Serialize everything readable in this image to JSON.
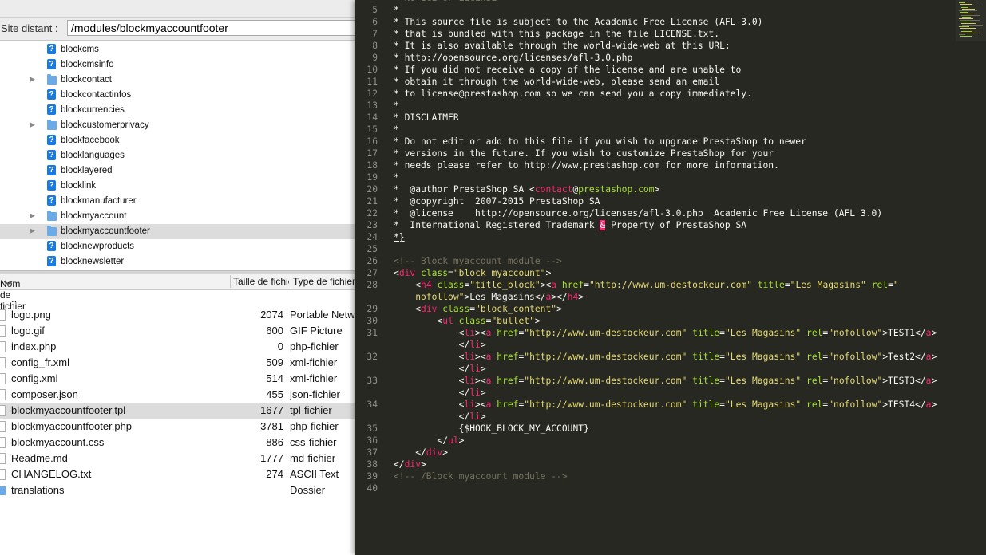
{
  "site_bar": {
    "label": "Site distant :",
    "path": "/modules/blockmyaccountfooter"
  },
  "tree": {
    "items": [
      {
        "name": "blockcms",
        "icon": "unknown-icon",
        "expandable": false,
        "selected": false
      },
      {
        "name": "blockcmsinfo",
        "icon": "unknown-icon",
        "expandable": false,
        "selected": false
      },
      {
        "name": "blockcontact",
        "icon": "folder-icon",
        "expandable": true,
        "selected": false
      },
      {
        "name": "blockcontactinfos",
        "icon": "unknown-icon",
        "expandable": false,
        "selected": false
      },
      {
        "name": "blockcurrencies",
        "icon": "unknown-icon",
        "expandable": false,
        "selected": false
      },
      {
        "name": "blockcustomerprivacy",
        "icon": "folder-icon",
        "expandable": true,
        "selected": false
      },
      {
        "name": "blockfacebook",
        "icon": "unknown-icon",
        "expandable": false,
        "selected": false
      },
      {
        "name": "blocklanguages",
        "icon": "unknown-icon",
        "expandable": false,
        "selected": false
      },
      {
        "name": "blocklayered",
        "icon": "unknown-icon",
        "expandable": false,
        "selected": false
      },
      {
        "name": "blocklink",
        "icon": "unknown-icon",
        "expandable": false,
        "selected": false
      },
      {
        "name": "blockmanufacturer",
        "icon": "unknown-icon",
        "expandable": false,
        "selected": false
      },
      {
        "name": "blockmyaccount",
        "icon": "folder-icon",
        "expandable": true,
        "selected": false
      },
      {
        "name": "blockmyaccountfooter",
        "icon": "folder-icon",
        "expandable": true,
        "selected": true
      },
      {
        "name": "blocknewproducts",
        "icon": "unknown-icon",
        "expandable": false,
        "selected": false
      },
      {
        "name": "blocknewsletter",
        "icon": "unknown-icon",
        "expandable": false,
        "selected": false
      }
    ]
  },
  "file_list": {
    "headers": {
      "name": "Nom de fichier",
      "size": "Taille de fichier",
      "type": "Type de fichier"
    },
    "rows": [
      {
        "name": "..",
        "size": "",
        "type": "",
        "icon": "none"
      },
      {
        "name": "logo.png",
        "size": "2074",
        "type": "Portable Network Graphics",
        "icon": "file"
      },
      {
        "name": "logo.gif",
        "size": "600",
        "type": "GIF Picture",
        "icon": "file"
      },
      {
        "name": "index.php",
        "size": "0",
        "type": "php-fichier",
        "icon": "file"
      },
      {
        "name": "config_fr.xml",
        "size": "509",
        "type": "xml-fichier",
        "icon": "file"
      },
      {
        "name": "config.xml",
        "size": "514",
        "type": "xml-fichier",
        "icon": "file"
      },
      {
        "name": "composer.json",
        "size": "455",
        "type": "json-fichier",
        "icon": "file"
      },
      {
        "name": "blockmyaccountfooter.tpl",
        "size": "1677",
        "type": "tpl-fichier",
        "icon": "file",
        "selected": true
      },
      {
        "name": "blockmyaccountfooter.php",
        "size": "3781",
        "type": "php-fichier",
        "icon": "file"
      },
      {
        "name": "blockmyaccount.css",
        "size": "886",
        "type": "css-fichier",
        "icon": "file"
      },
      {
        "name": "Readme.md",
        "size": "1777",
        "type": "md-fichier",
        "icon": "file"
      },
      {
        "name": "CHANGELOG.txt",
        "size": "274",
        "type": "ASCII Text",
        "icon": "file"
      },
      {
        "name": "translations",
        "size": "",
        "type": "Dossier",
        "icon": "folder"
      }
    ]
  },
  "editor": {
    "theme": {
      "bg": "#272822",
      "text": "#f8f8f2",
      "comment": "#75715e",
      "tag": "#f92672",
      "attr": "#a6e22e",
      "string": "#e6db74",
      "gutter": "#8f908a"
    },
    "lines": [
      {
        "n": "",
        "t": [
          [
            "c",
            "* NOTICE OF LICENSE"
          ]
        ]
      },
      {
        "n": "5",
        "t": [
          [
            "t",
            "*"
          ]
        ]
      },
      {
        "n": "6",
        "t": [
          [
            "t",
            "* This source file is subject to the Academic Free License (AFL 3.0)"
          ]
        ]
      },
      {
        "n": "7",
        "t": [
          [
            "t",
            "* that is bundled with this package in the file LICENSE.txt."
          ]
        ]
      },
      {
        "n": "8",
        "t": [
          [
            "t",
            "* It is also available through the world-wide-web at this URL:"
          ]
        ]
      },
      {
        "n": "9",
        "t": [
          [
            "t",
            "* http://opensource.org/licenses/afl-3.0.php"
          ]
        ]
      },
      {
        "n": "10",
        "t": [
          [
            "t",
            "* If you did not receive a copy of the license and are unable to"
          ]
        ]
      },
      {
        "n": "11",
        "t": [
          [
            "t",
            "* obtain it through the world-wide-web, please send an email"
          ]
        ]
      },
      {
        "n": "12",
        "t": [
          [
            "t",
            "* to license@prestashop.com so we can send you a copy immediately."
          ]
        ]
      },
      {
        "n": "13",
        "t": [
          [
            "t",
            "*"
          ]
        ]
      },
      {
        "n": "14",
        "t": [
          [
            "t",
            "* DISCLAIMER"
          ]
        ]
      },
      {
        "n": "15",
        "t": [
          [
            "t",
            "*"
          ]
        ]
      },
      {
        "n": "16",
        "t": [
          [
            "t",
            "* Do not edit or add to this file if you wish to upgrade PrestaShop to newer"
          ]
        ]
      },
      {
        "n": "17",
        "t": [
          [
            "t",
            "* versions in the future. If you wish to customize PrestaShop for your"
          ]
        ]
      },
      {
        "n": "18",
        "t": [
          [
            "t",
            "* needs please refer to http://www.prestashop.com for more information."
          ]
        ]
      },
      {
        "n": "19",
        "t": [
          [
            "t",
            "*"
          ]
        ]
      },
      {
        "n": "20",
        "t": [
          [
            "t",
            "*  @author PrestaShop SA <"
          ],
          [
            "g",
            "contact"
          ],
          [
            "t",
            "@"
          ],
          [
            "a",
            "prestashop.com"
          ],
          [
            "t",
            ">"
          ]
        ]
      },
      {
        "n": "21",
        "t": [
          [
            "t",
            "*  @copyright  2007-2015 PrestaShop SA"
          ]
        ]
      },
      {
        "n": "22",
        "t": [
          [
            "t",
            "*  @license    http://opensource.org/licenses/afl-3.0.php  Academic Free License (AFL 3.0)"
          ]
        ]
      },
      {
        "n": "23",
        "t": [
          [
            "t",
            "*  International Registered Trademark "
          ],
          [
            "hl",
            "&"
          ],
          [
            "t",
            " Property of PrestaShop SA"
          ]
        ]
      },
      {
        "n": "24",
        "t": [
          [
            "cur",
            "*}"
          ]
        ]
      },
      {
        "n": "25",
        "t": []
      },
      {
        "n": "26",
        "t": [
          [
            "c",
            "<!-- Block myaccount module -->"
          ]
        ]
      },
      {
        "n": "27",
        "t": [
          [
            "t",
            "<"
          ],
          [
            "g",
            "div"
          ],
          [
            "t",
            " "
          ],
          [
            "a",
            "class"
          ],
          [
            "t",
            "="
          ],
          [
            "s",
            "\"block myaccount\""
          ],
          [
            "t",
            ">"
          ]
        ]
      },
      {
        "n": "28",
        "t": [
          [
            "t",
            "    <"
          ],
          [
            "g",
            "h4"
          ],
          [
            "t",
            " "
          ],
          [
            "a",
            "class"
          ],
          [
            "t",
            "="
          ],
          [
            "s",
            "\"title_block\""
          ],
          [
            "t",
            "><"
          ],
          [
            "g",
            "a"
          ],
          [
            "t",
            " "
          ],
          [
            "a",
            "href"
          ],
          [
            "t",
            "="
          ],
          [
            "s",
            "\"http://www.um-destockeur.com\""
          ],
          [
            "t",
            " "
          ],
          [
            "a",
            "title"
          ],
          [
            "t",
            "="
          ],
          [
            "s",
            "\"Les Magasins\""
          ],
          [
            "t",
            " "
          ],
          [
            "a",
            "rel"
          ],
          [
            "t",
            "="
          ],
          [
            "s",
            "\""
          ]
        ]
      },
      {
        "n": "",
        "t": [
          [
            "s",
            "    nofollow\""
          ],
          [
            "t",
            ">Les Magasins</"
          ],
          [
            "g",
            "a"
          ],
          [
            "t",
            "></"
          ],
          [
            "g",
            "h4"
          ],
          [
            "t",
            ">"
          ]
        ]
      },
      {
        "n": "29",
        "t": [
          [
            "t",
            "    <"
          ],
          [
            "g",
            "div"
          ],
          [
            "t",
            " "
          ],
          [
            "a",
            "class"
          ],
          [
            "t",
            "="
          ],
          [
            "s",
            "\"block_content\""
          ],
          [
            "t",
            ">"
          ]
        ]
      },
      {
        "n": "30",
        "t": [
          [
            "t",
            "        <"
          ],
          [
            "g",
            "ul"
          ],
          [
            "t",
            " "
          ],
          [
            "a",
            "class"
          ],
          [
            "t",
            "="
          ],
          [
            "s",
            "\"bullet\""
          ],
          [
            "t",
            ">"
          ]
        ]
      },
      {
        "n": "31",
        "t": [
          [
            "t",
            "            <"
          ],
          [
            "g",
            "li"
          ],
          [
            "t",
            "><"
          ],
          [
            "g",
            "a"
          ],
          [
            "t",
            " "
          ],
          [
            "a",
            "href"
          ],
          [
            "t",
            "="
          ],
          [
            "s",
            "\"http://www.um-destockeur.com\""
          ],
          [
            "t",
            " "
          ],
          [
            "a",
            "title"
          ],
          [
            "t",
            "="
          ],
          [
            "s",
            "\"Les Magasins\""
          ],
          [
            "t",
            " "
          ],
          [
            "a",
            "rel"
          ],
          [
            "t",
            "="
          ],
          [
            "s",
            "\"nofollow\""
          ],
          [
            "t",
            ">TEST1</"
          ],
          [
            "g",
            "a"
          ],
          [
            "t",
            ">"
          ]
        ]
      },
      {
        "n": "",
        "t": [
          [
            "t",
            "            </"
          ],
          [
            "g",
            "li"
          ],
          [
            "t",
            ">"
          ]
        ]
      },
      {
        "n": "32",
        "t": [
          [
            "t",
            "            <"
          ],
          [
            "g",
            "li"
          ],
          [
            "t",
            "><"
          ],
          [
            "g",
            "a"
          ],
          [
            "t",
            " "
          ],
          [
            "a",
            "href"
          ],
          [
            "t",
            "="
          ],
          [
            "s",
            "\"http://www.um-destockeur.com\""
          ],
          [
            "t",
            " "
          ],
          [
            "a",
            "title"
          ],
          [
            "t",
            "="
          ],
          [
            "s",
            "\"Les Magasins\""
          ],
          [
            "t",
            " "
          ],
          [
            "a",
            "rel"
          ],
          [
            "t",
            "="
          ],
          [
            "s",
            "\"nofollow\""
          ],
          [
            "t",
            ">Test2</"
          ],
          [
            "g",
            "a"
          ],
          [
            "t",
            ">"
          ]
        ]
      },
      {
        "n": "",
        "t": [
          [
            "t",
            "            </"
          ],
          [
            "g",
            "li"
          ],
          [
            "t",
            ">"
          ]
        ]
      },
      {
        "n": "33",
        "t": [
          [
            "t",
            "            <"
          ],
          [
            "g",
            "li"
          ],
          [
            "t",
            "><"
          ],
          [
            "g",
            "a"
          ],
          [
            "t",
            " "
          ],
          [
            "a",
            "href"
          ],
          [
            "t",
            "="
          ],
          [
            "s",
            "\"http://www.um-destockeur.com\""
          ],
          [
            "t",
            " "
          ],
          [
            "a",
            "title"
          ],
          [
            "t",
            "="
          ],
          [
            "s",
            "\"Les Magasins\""
          ],
          [
            "t",
            " "
          ],
          [
            "a",
            "rel"
          ],
          [
            "t",
            "="
          ],
          [
            "s",
            "\"nofollow\""
          ],
          [
            "t",
            ">TEST3</"
          ],
          [
            "g",
            "a"
          ],
          [
            "t",
            ">"
          ]
        ]
      },
      {
        "n": "",
        "t": [
          [
            "t",
            "            </"
          ],
          [
            "g",
            "li"
          ],
          [
            "t",
            ">"
          ]
        ]
      },
      {
        "n": "34",
        "t": [
          [
            "t",
            "            <"
          ],
          [
            "g",
            "li"
          ],
          [
            "t",
            "><"
          ],
          [
            "g",
            "a"
          ],
          [
            "t",
            " "
          ],
          [
            "a",
            "href"
          ],
          [
            "t",
            "="
          ],
          [
            "s",
            "\"http://www.um-destockeur.com\""
          ],
          [
            "t",
            " "
          ],
          [
            "a",
            "title"
          ],
          [
            "t",
            "="
          ],
          [
            "s",
            "\"Les Magasins\""
          ],
          [
            "t",
            " "
          ],
          [
            "a",
            "rel"
          ],
          [
            "t",
            "="
          ],
          [
            "s",
            "\"nofollow\""
          ],
          [
            "t",
            ">TEST4</"
          ],
          [
            "g",
            "a"
          ],
          [
            "t",
            ">"
          ]
        ]
      },
      {
        "n": "",
        "t": [
          [
            "t",
            "            </"
          ],
          [
            "g",
            "li"
          ],
          [
            "t",
            ">"
          ]
        ]
      },
      {
        "n": "35",
        "t": [
          [
            "t",
            "            {$HOOK_BLOCK_MY_ACCOUNT}"
          ]
        ]
      },
      {
        "n": "36",
        "t": [
          [
            "t",
            "        </"
          ],
          [
            "g",
            "ul"
          ],
          [
            "t",
            ">"
          ]
        ]
      },
      {
        "n": "37",
        "t": [
          [
            "t",
            "    </"
          ],
          [
            "g",
            "div"
          ],
          [
            "t",
            ">"
          ]
        ]
      },
      {
        "n": "38",
        "t": [
          [
            "t",
            "</"
          ],
          [
            "g",
            "div"
          ],
          [
            "t",
            ">"
          ]
        ]
      },
      {
        "n": "39",
        "t": [
          [
            "c",
            "<!-- /Block myaccount module -->"
          ]
        ]
      },
      {
        "n": "40",
        "t": []
      }
    ]
  }
}
